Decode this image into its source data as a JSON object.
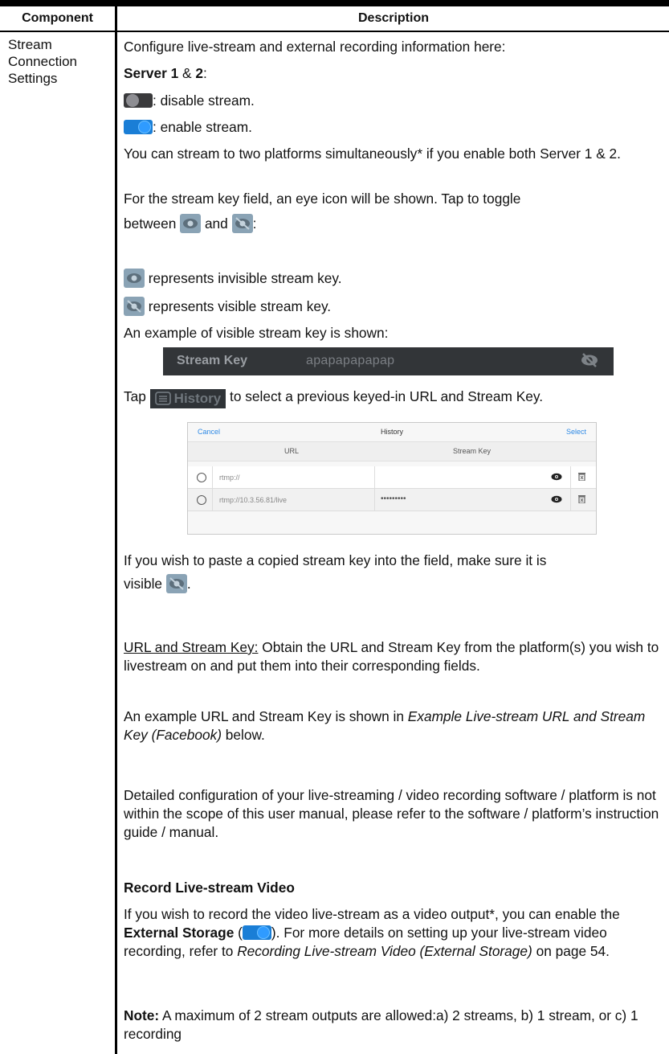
{
  "table": {
    "header_component": "Component",
    "header_description": "Description",
    "component_line1": "Stream",
    "component_line2": "Connection",
    "component_line3": "Settings"
  },
  "desc": {
    "intro": "Configure live-stream and external recording information here:",
    "server_bold_a": "Server 1",
    "server_mid": " & ",
    "server_bold_b": "2",
    "server_colon": ":",
    "disable": ": disable stream.",
    "enable": ": enable stream.",
    "simul": "You can stream to two platforms simultaneously* if you enable both Server 1 & 2.",
    "eye_line1": "For the stream key field, an eye icon will be shown. Tap to toggle",
    "between": "between ",
    "and": " and ",
    "eye_colon": ":",
    "invisible": " represents invisible stream key.",
    "visible": " represents visible stream key.",
    "example_visible": "An example of visible stream key is shown:",
    "tap": "Tap ",
    "tap_rest": " to select a previous keyed-in URL and Stream Key.",
    "paste_line1": "If you wish to paste a copied stream key into the field, make sure it is",
    "paste_visible": "visible ",
    "paste_period": ".",
    "url_label": "URL and Stream Key:",
    "url_text": " Obtain the URL and Stream Key from the platform(s) you wish to livestream on and put them into their corresponding fields.",
    "example_a": "An example URL and Stream Key is shown in ",
    "example_italic": " Example Live-stream URL and Stream Key (Facebook)",
    "example_b": " below.",
    "detailed": "Detailed configuration of your live-streaming / video recording software / platform is not within the scope of this user manual, please refer to the software / platform’s instruction guide / manual.",
    "record_heading": "Record Live-stream Video",
    "record_a": "If you wish to record the video live-stream as a video output*, you can enable the ",
    "record_bold": "External Storage",
    "record_paren_open": " (",
    "record_paren_close": "). For more details on setting up your live-stream video recording, refer to ",
    "record_italic": "Recording Live-stream Video (External Storage)",
    "record_b": " on page 54.",
    "note_bold": "Note:",
    "note_text": " A maximum of 2 stream outputs are allowed:a) 2 streams, b)  1 stream, or c) 1 recording"
  },
  "stream_key_bar": {
    "label": "Stream Key",
    "value": "apapapapapap"
  },
  "history_button": {
    "label": "History"
  },
  "history": {
    "cancel": "Cancel",
    "title": "History",
    "select": "Select",
    "col_url": "URL",
    "col_key": "Stream Key",
    "rows": [
      {
        "url": "rtmp://",
        "key": ""
      },
      {
        "url": "rtmp://10.3.56.81/live",
        "key": "•••••••••"
      }
    ]
  },
  "colors": {
    "toggle_on": "#1a7ed6",
    "toggle_off": "#3a3a3c",
    "link_blue": "#2f8ae5",
    "tile_grey": "#8aa3b5"
  },
  "icons": [
    "toggle-off-icon",
    "toggle-on-icon",
    "eye-icon",
    "eye-slash-icon",
    "history-list-icon",
    "trash-icon",
    "radio-icon"
  ]
}
